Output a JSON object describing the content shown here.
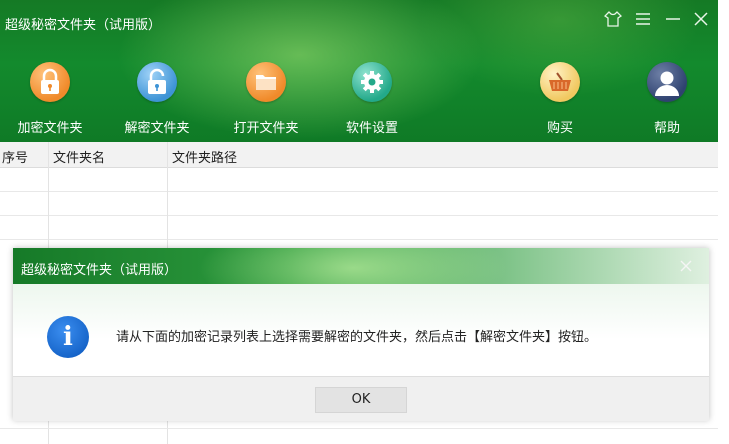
{
  "window": {
    "title": "超级秘密文件夹（试用版）",
    "controls": [
      {
        "icon": "shirt-icon",
        "glyph": "⛉"
      },
      {
        "icon": "menu-icon",
        "glyph": "☰"
      },
      {
        "icon": "minimize-icon",
        "glyph": "−"
      },
      {
        "icon": "close-icon",
        "glyph": "✕"
      }
    ]
  },
  "toolbar": {
    "items": [
      {
        "label": "加密文件夹",
        "icon": "lock-closed-icon",
        "color": "#f08a2a"
      },
      {
        "label": "解密文件夹",
        "icon": "lock-open-icon",
        "color": "#3e94d6"
      },
      {
        "label": "打开文件夹",
        "icon": "folder-icon",
        "color": "#f08a2a"
      },
      {
        "label": "软件设置",
        "icon": "gear-icon",
        "color": "#23a98a"
      },
      {
        "label": "购买",
        "icon": "basket-icon",
        "color": "#f1c860"
      },
      {
        "label": "帮助",
        "icon": "user-icon",
        "color": "#2f4270"
      }
    ]
  },
  "table": {
    "columns": [
      "序号",
      "文件夹名",
      "文件夹路径"
    ],
    "rows": []
  },
  "dialog": {
    "title": "超级秘密文件夹（试用版）",
    "close_glyph": "✕",
    "icon": "info-icon",
    "icon_glyph": "i",
    "message": "请从下面的加密记录列表上选择需要解密的文件夹，然后点击【解密文件夹】按钮。",
    "ok_label": "OK"
  },
  "colors": {
    "header_green": "#138a2d",
    "info_blue": "#1563c8"
  }
}
